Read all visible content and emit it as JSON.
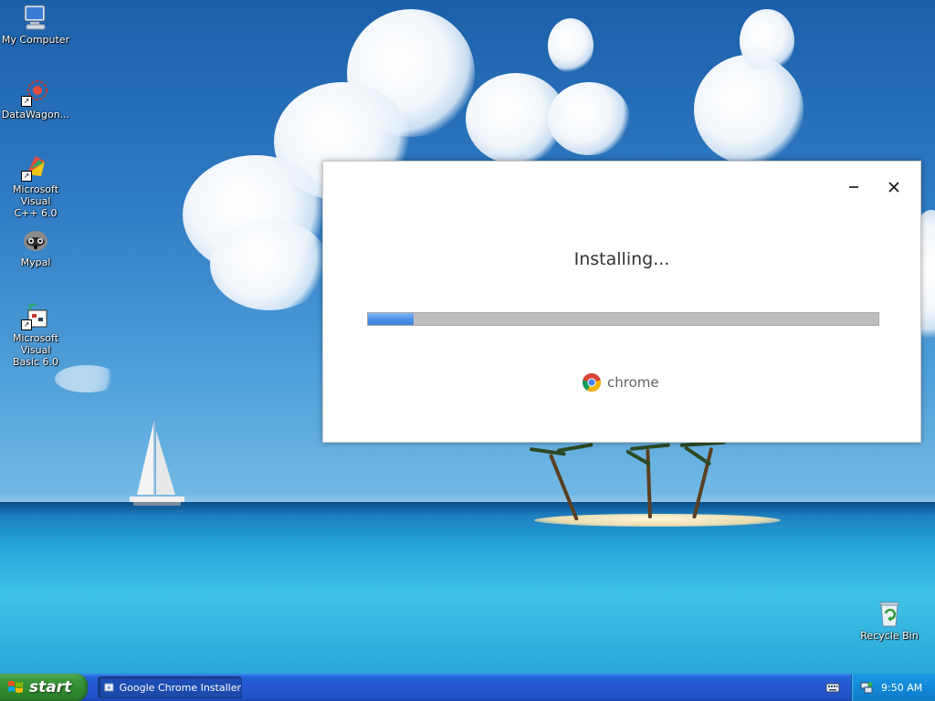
{
  "desktop": {
    "icons": [
      {
        "label": "My Computer"
      },
      {
        "label": "DataWagon..."
      },
      {
        "label": "Microsoft Visual\nC++ 6.0"
      },
      {
        "label": "Mypal"
      },
      {
        "label": "Microsoft Visual\nBasic 6.0"
      },
      {
        "label": "Recycle Bin"
      }
    ]
  },
  "installer": {
    "status_text": "Installing...",
    "progress": 0.09,
    "brand_text": "chrome",
    "minimize_icon": "minimize-icon",
    "close_icon": "close-icon"
  },
  "taskbar": {
    "start_label": "start",
    "tasks": [
      {
        "label": "Google Chrome Installer"
      }
    ],
    "clock": "9:50 AM"
  },
  "colors": {
    "progress_fill": "#4f93e8",
    "progress_track": "#bdbdbd",
    "taskbar": "#2457d0",
    "start_button": "#3c9a3c",
    "tray": "#138ad9"
  }
}
